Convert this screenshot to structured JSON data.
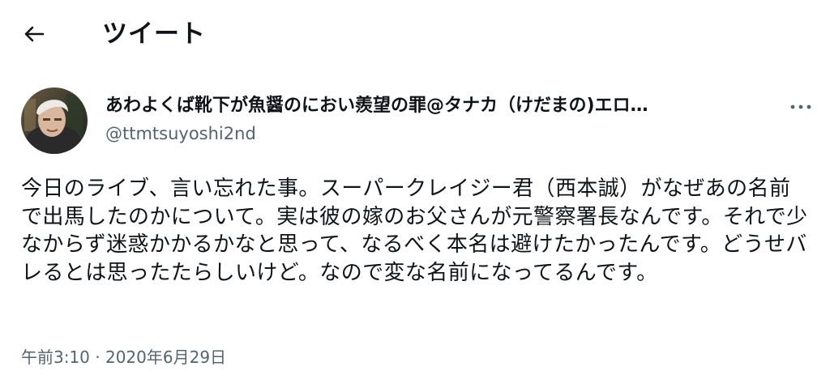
{
  "header": {
    "back_icon": "arrow-left-icon",
    "title": "ツイート"
  },
  "author": {
    "avatar_icon": "profile-avatar",
    "display_name": "あわよくば靴下が魚醤のにおい羨望の罪@タナカ（けだまの)エロ…",
    "handle": "@ttmtsuyoshi2nd",
    "more_icon": "more-horizontal-icon"
  },
  "tweet": {
    "text": "今日のライブ、言い忘れた事。スーパークレイジー君（西本誠）がなぜあの名前で出馬したのかについて。実は彼の嫁のお父さんが元警察署長なんです。それで少なからず迷惑かかるかなと思って、なるべく本名は避けたかったんです。どうせバレるとは思ったたらしいけど。なので変な名前になってるんです。",
    "timestamp": "午前3:10 · 2020年6月29日"
  },
  "colors": {
    "text_primary": "#0f1419",
    "text_secondary": "#536471",
    "background": "#ffffff"
  }
}
